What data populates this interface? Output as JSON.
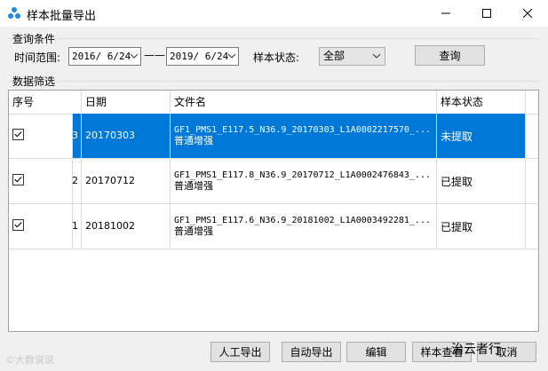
{
  "window": {
    "title": "样本批量导出"
  },
  "query": {
    "group_title": "查询条件",
    "time_label": "时间范围:",
    "start_date": "2016/ 6/24",
    "separator": "——",
    "end_date": "2019/ 6/24",
    "status_label": "样本状态:",
    "status_value": "全部",
    "query_button": "查询"
  },
  "filter": {
    "group_title": "数据筛选"
  },
  "table": {
    "columns": [
      "序号",
      "日期",
      "文件名",
      "样本状态"
    ],
    "rows": [
      {
        "index": "3",
        "date": "20170303",
        "filename": "GF1_PMS1_E117.5_N36.9_20170303_L1A0002217570_...",
        "filename2": "普通增强",
        "status": "未提取",
        "checked": true,
        "selected": true
      },
      {
        "index": "2",
        "date": "20170712",
        "filename": "GF1_PMS1_E117.8_N36.9_20170712_L1A0002476843_...",
        "filename2": "普通增强",
        "status": "已提取",
        "checked": true,
        "selected": false
      },
      {
        "index": "1",
        "date": "20181002",
        "filename": "GF1_PMS1_E117.6_N36.9_20181002_L1A0003492281_...",
        "filename2": "普通增强",
        "status": "已提取",
        "checked": true,
        "selected": false
      }
    ]
  },
  "buttons": {
    "manual_export": "人工导出",
    "auto_export": "自动导出",
    "edit": "编辑",
    "sample_view": "样本查看",
    "cancel": "取消"
  },
  "watermarks": {
    "left": "©大数说说",
    "right": "治云者行"
  }
}
